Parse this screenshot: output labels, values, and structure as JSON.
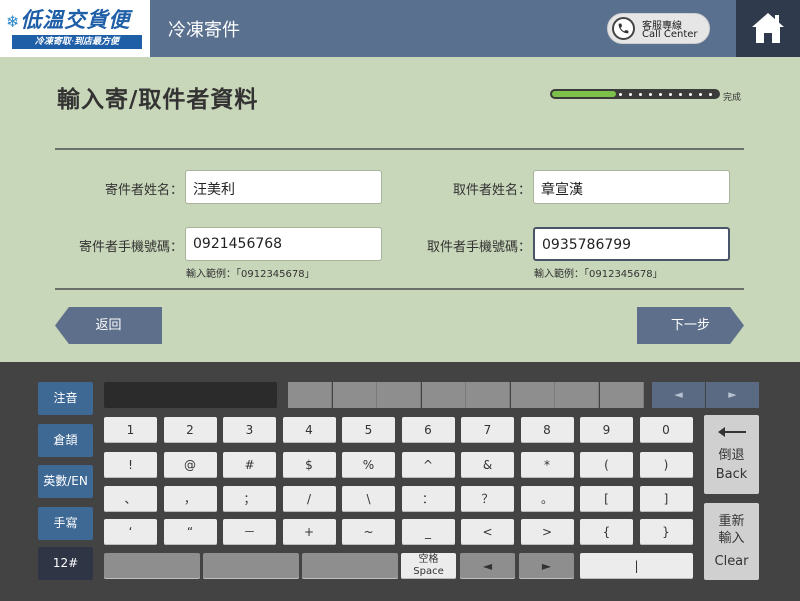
{
  "header": {
    "logo_text": "低溫交貨便",
    "logo_slogan": "冷凍寄取‧到店最方便",
    "title": "冷凍寄件",
    "call_center_zh": "客服專線",
    "call_center_en": "Call Center"
  },
  "page": {
    "title": "輸入寄/取件者資料",
    "progress_label": "完成",
    "progress_fraction": 0.38
  },
  "form": {
    "sender_name_label": "寄件者姓名：",
    "sender_name_value": "汪美利",
    "receiver_name_label": "取件者姓名：",
    "receiver_name_value": "章宣漢",
    "sender_phone_label": "寄件者手機號碼：",
    "sender_phone_value": "0921456768",
    "receiver_phone_label": "取件者手機號碼：",
    "receiver_phone_value": "0935786799",
    "phone_hint": "輸入範例：「0912345678」"
  },
  "nav": {
    "back_label": "返回",
    "next_label": "下一步"
  },
  "keyboard": {
    "modes": [
      "注音",
      "倉頡",
      "英數/EN",
      "手寫",
      "12#"
    ],
    "arrow_left": "◄",
    "arrow_right": "►",
    "rows": [
      [
        "1",
        "2",
        "3",
        "4",
        "5",
        "6",
        "7",
        "8",
        "9",
        "0"
      ],
      [
        "!",
        "@",
        "#",
        "$",
        "%",
        "^",
        "&",
        "*",
        "(",
        ")"
      ],
      [
        "、",
        "，",
        "；",
        "/",
        "\\",
        "：",
        "？",
        "。",
        "[",
        "]"
      ],
      [
        "‘",
        "“",
        "－",
        "+",
        "~",
        "_",
        "<",
        ">",
        "{",
        "}"
      ]
    ],
    "space_zh": "空格",
    "space_en": "Space",
    "left_key": "◄",
    "right_key": "►",
    "pipe_key": "|",
    "backspace_zh": "倒退",
    "backspace_en": "Back",
    "clear_zh_1": "重新",
    "clear_zh_2": "輸入",
    "clear_en": "Clear"
  }
}
